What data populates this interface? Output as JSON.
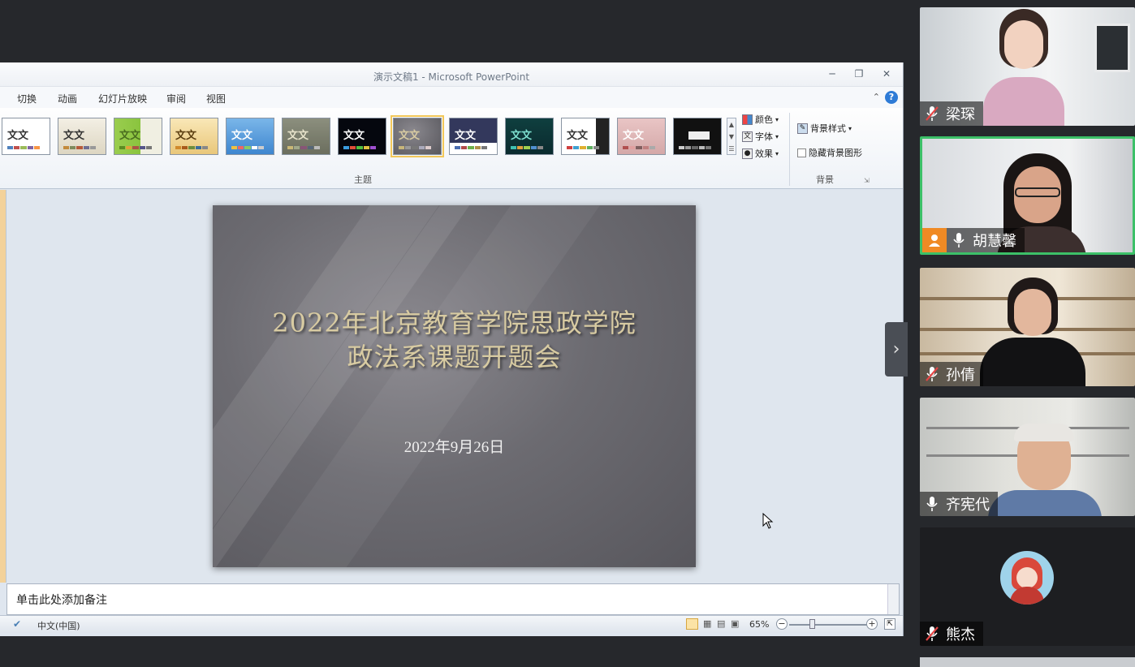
{
  "window": {
    "title": "演示文稿1 - Microsoft PowerPoint"
  },
  "ribbon": {
    "tabs": [
      "切换",
      "动画",
      "幻灯片放映",
      "审阅",
      "视图"
    ],
    "themes_group_label": "主题",
    "theme_sample_text": "文文",
    "colors_label": "颜色",
    "fonts_label": "字体",
    "effects_label": "效果",
    "background_styles_label": "背景样式",
    "hide_background_label": "隐藏背景图形",
    "background_group_label": "背景"
  },
  "slide": {
    "title_line1": "2022年北京教育学院思政学院",
    "title_line2": "政法系课题开题会",
    "date": "2022年9月26日"
  },
  "notes": {
    "placeholder": "单击此处添加备注"
  },
  "statusbar": {
    "language": "中文(中国)",
    "zoom": "65%"
  },
  "participants": [
    {
      "name": "梁琛",
      "mic": "muted",
      "active": false
    },
    {
      "name": "胡慧馨",
      "mic": "on",
      "active": true
    },
    {
      "name": "孙倩",
      "mic": "muted",
      "active": false
    },
    {
      "name": "齐宪代",
      "mic": "on",
      "active": false
    },
    {
      "name": "熊杰",
      "mic": "muted",
      "active": false
    }
  ],
  "colors": {
    "active_speaker_border": "#3cc068",
    "slide_title": "#d8cba2",
    "app_background": "#26282c"
  }
}
